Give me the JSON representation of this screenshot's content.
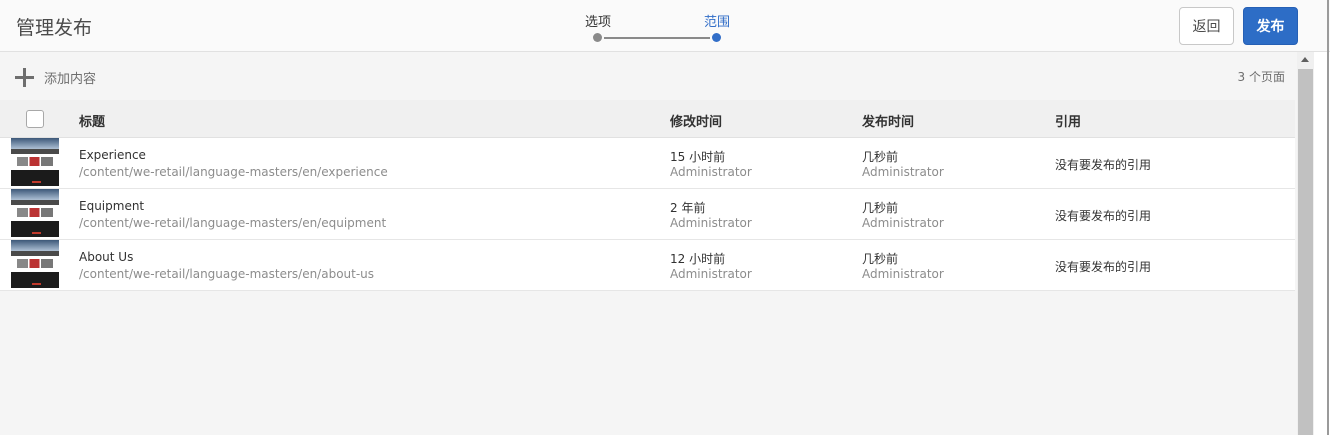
{
  "app": {
    "title": "管理发布"
  },
  "wizard": {
    "steps": [
      {
        "label": "选项",
        "state": "done"
      },
      {
        "label": "范围",
        "state": "active"
      }
    ]
  },
  "header": {
    "back_label": "返回",
    "publish_label": "发布"
  },
  "toolbar": {
    "add_label": "添加内容",
    "count_label": "3 个页面"
  },
  "table": {
    "columns": [
      "标题",
      "修改时间",
      "发布时间",
      "引用"
    ],
    "rows": [
      {
        "title": "Experience",
        "path": "/content/we-retail/language-masters/en/experience",
        "modified": "15 小时前",
        "modified_by": "Administrator",
        "published": "几秒前",
        "published_by": "Administrator",
        "references": "没有要发布的引用"
      },
      {
        "title": "Equipment",
        "path": "/content/we-retail/language-masters/en/equipment",
        "modified": "2 年前",
        "modified_by": "Administrator",
        "published": "几秒前",
        "published_by": "Administrator",
        "references": "没有要发布的引用"
      },
      {
        "title": "About Us",
        "path": "/content/we-retail/language-masters/en/about-us",
        "modified": "12 小时前",
        "modified_by": "Administrator",
        "published": "几秒前",
        "published_by": "Administrator",
        "references": "没有要发布的引用"
      }
    ]
  },
  "colors": {
    "accent": "#2d6dc6",
    "active_step": "#326ec8",
    "inactive_step": "#8a8a8a"
  },
  "icons": {
    "add": "plus-icon",
    "thumbnail": "page-thumbnail"
  }
}
